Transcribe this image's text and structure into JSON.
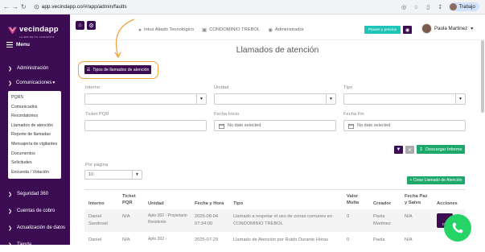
{
  "browser": {
    "url": "app.vecindapp.co/#/app/admin/faults",
    "profile": "Trabajo"
  },
  "sidebar": {
    "logo": "vecindapp",
    "logo_sub": "LA APP DE TU CONJUNTO",
    "menu": "Menu",
    "items": [
      {
        "label": "Administración"
      },
      {
        "label": "Comunicaciones"
      },
      {
        "label": "Seguridad 360"
      },
      {
        "label": "Cuentas de cobro"
      },
      {
        "label": "Actualización de datos"
      },
      {
        "label": "Tienda"
      }
    ],
    "submenu": [
      "PQRS",
      "Comunicados",
      "Recordatorios",
      "Llamados de atención",
      "Reporte de llamadas",
      "Mensajería de vigilantes",
      "Documentos",
      "Solicitudes",
      "Encuesta / Votación"
    ]
  },
  "topbar": {
    "role": "Intus Aliado Tecnológico",
    "building": "CONDOMINIO TREBOL",
    "admin": "Administrador",
    "plans": "Planes y precios",
    "user": "Paola Martinez"
  },
  "main": {
    "title": "Llamados de atención",
    "types_button": "Tipos de llamados de atención",
    "filters": {
      "interno": "Interno",
      "unidad": "Unidad",
      "tipo": "Tipo",
      "ticket": "Ticket PQR",
      "fecha_inicio": "Fecha Inicio",
      "fecha_fin": "Fecha Fin",
      "no_date": "No date selected"
    },
    "download": "Descargar Informe",
    "per_page_label": "Por página",
    "per_page_value": "10",
    "create": "+ Crear Llamado de Atención"
  },
  "table": {
    "headers": [
      "Interno",
      "Ticket PQR",
      "Unidad",
      "Fecha y Hora",
      "Tipo",
      "Valor Multa",
      "Creador",
      "Fecha Paz y Salvo",
      "Acciones"
    ],
    "rows": [
      {
        "interno": "Daniel Sandoval",
        "ticket": "N/A",
        "unidad": "Apto 302 - Propietario Residente",
        "fecha": "2025-08-04 07:34:00",
        "tipo": "Llamado a respetar el uso de zonas comunes en CONDOMINIO TREBOL",
        "multa": "0",
        "creador": "Paola Martinez",
        "paz": "N/A",
        "accion": "Op"
      },
      {
        "interno": "Daniel",
        "ticket": "N/A",
        "unidad": "Apto 302 -",
        "fecha": "2025-07-29",
        "tipo": "Llamado de Atención por Ruido Durante Horas",
        "multa": "0",
        "creador": "Paola",
        "paz": "N/A",
        "accion": ""
      }
    ]
  },
  "colors": {
    "brand": "#3b0c52",
    "accent": "#1ec4b7",
    "success": "#1ea86a",
    "highlight": "#f0a23c"
  }
}
